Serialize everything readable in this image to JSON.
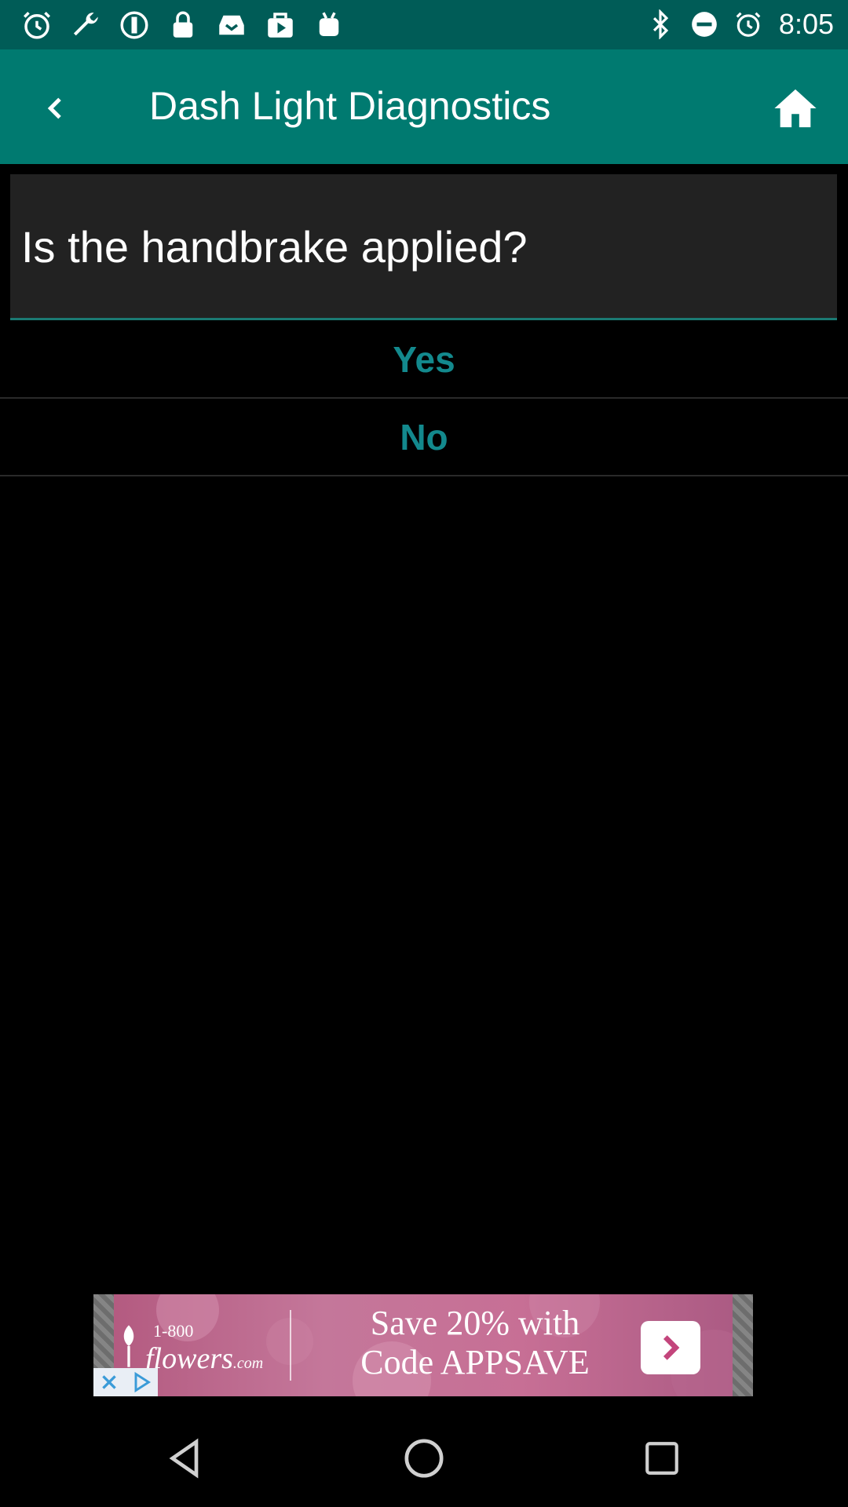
{
  "status_bar": {
    "time": "8:05",
    "left_icons": [
      "alarm-icon",
      "wrench-icon",
      "info-circle-icon",
      "lock-icon",
      "inbox-icon",
      "play-store-icon",
      "android-icon"
    ],
    "right_icons": [
      "bluetooth-icon",
      "do-not-disturb-icon",
      "alarm-icon"
    ]
  },
  "app_bar": {
    "title": "Dash Light Diagnostics",
    "back_icon": "chevron-left-icon",
    "home_icon": "home-icon"
  },
  "question": {
    "text": "Is the handbrake applied?"
  },
  "options": [
    {
      "label": "Yes"
    },
    {
      "label": "No"
    }
  ],
  "ad": {
    "logo_top": "1-800",
    "logo_main": "flowers",
    "logo_suffix": ".com",
    "headline_line1": "Save 20% with",
    "headline_line2": "Code APPSAVE",
    "arrow_icon": "chevron-right-icon",
    "controls": [
      "close-icon",
      "ad-choices-icon"
    ]
  },
  "nav_bar": {
    "buttons": [
      "back-triangle-icon",
      "home-circle-icon",
      "recents-square-icon"
    ]
  },
  "colors": {
    "status_bar": "#005c57",
    "app_bar": "#007a70",
    "card": "#222222",
    "option_text": "#13898d",
    "background": "#000000"
  }
}
